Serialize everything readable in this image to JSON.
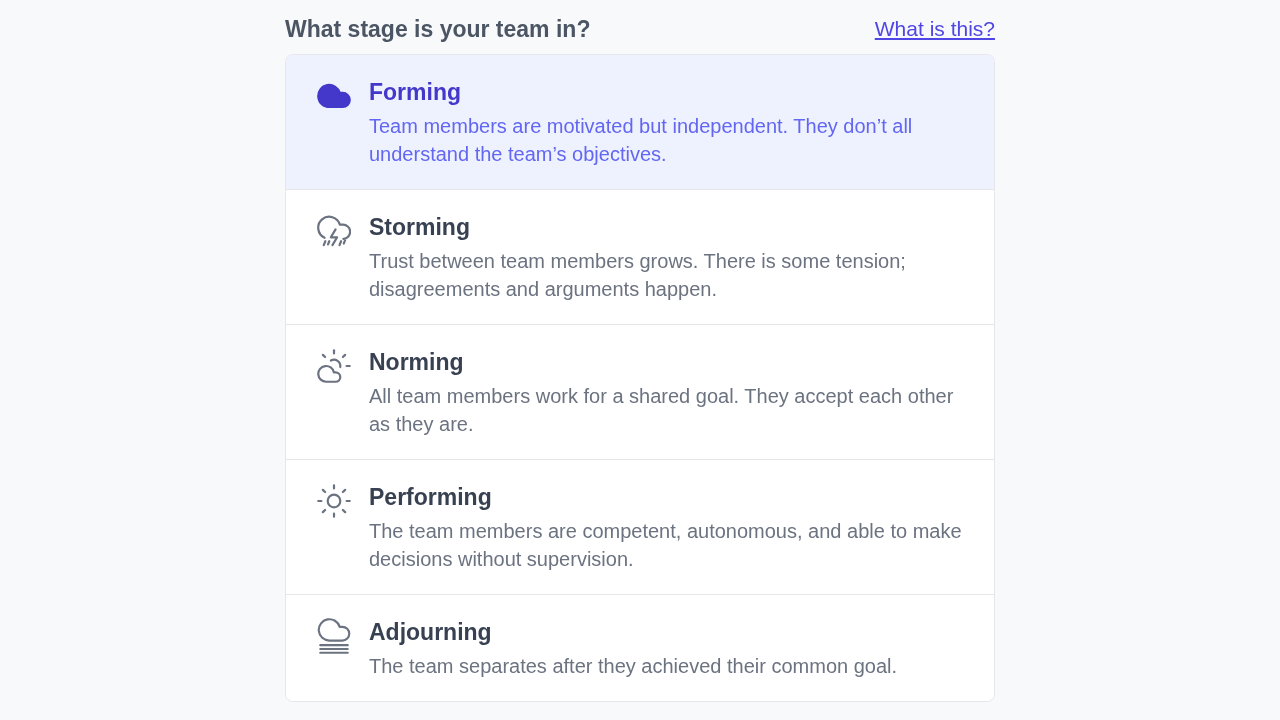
{
  "question": {
    "title": "What stage is your team in?",
    "help_link": "What is this?"
  },
  "stages": [
    {
      "title": "Forming",
      "description": "Team members are motivated but independent. They don’t all understand the team’s objectives.",
      "selected": true
    },
    {
      "title": "Storming",
      "description": "Trust between team members grows. There is some tension; disagreements and arguments happen.",
      "selected": false
    },
    {
      "title": "Norming",
      "description": "All team members work for a shared goal. They accept each other as they are.",
      "selected": false
    },
    {
      "title": "Performing",
      "description": "The team members are competent, autonomous, and able to make decisions without supervision.",
      "selected": false
    },
    {
      "title": "Adjourning",
      "description": "The team separates after they achieved their common goal.",
      "selected": false
    }
  ]
}
